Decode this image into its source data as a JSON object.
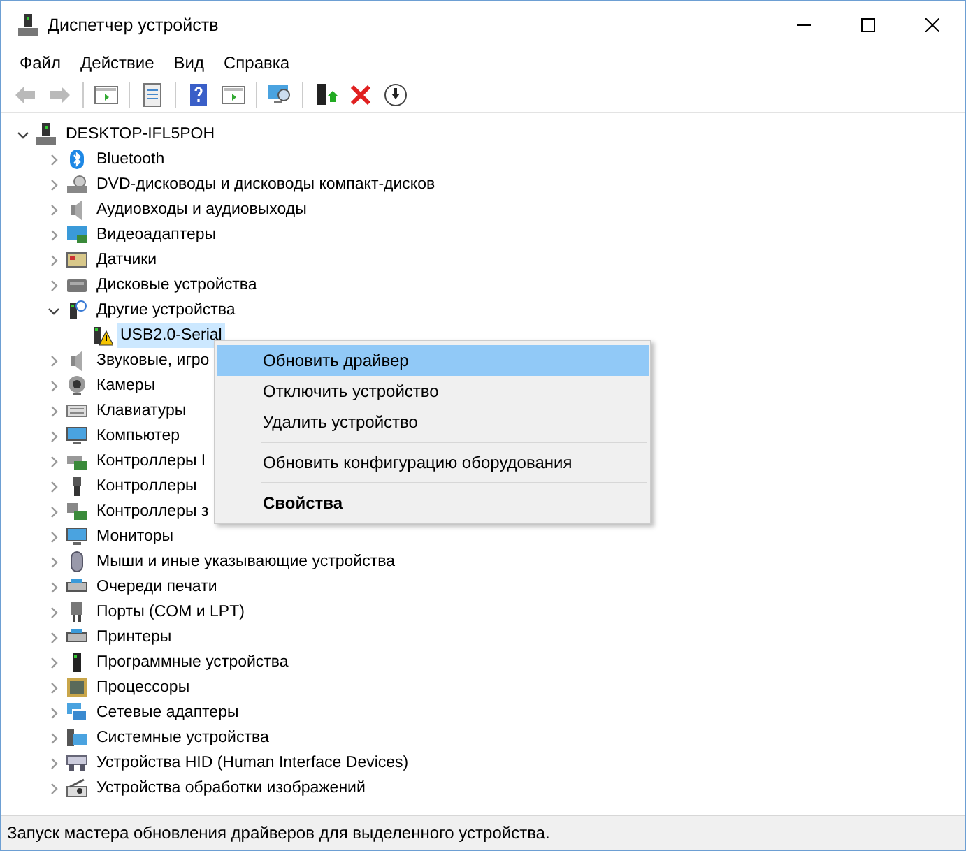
{
  "window": {
    "title": "Диспетчер устройств"
  },
  "menu_bar": [
    "Файл",
    "Действие",
    "Вид",
    "Справка"
  ],
  "toolbar": [
    {
      "disabled": true
    },
    {
      "disabled": true
    },
    {
      "disabled": false
    },
    {
      "disabled": false
    },
    {
      "disabled": false
    },
    {
      "disabled": false
    },
    {
      "disabled": false
    },
    {
      "disabled": false
    },
    {
      "disabled": false
    },
    {
      "disabled": false
    }
  ],
  "tree": {
    "label": "DESKTOP-IFL5POH",
    "expanded": true,
    "selected": false,
    "children": [
      {
        "label": "Bluetooth",
        "expanded": false,
        "selected": false
      },
      {
        "label": "DVD-дисководы и дисководы компакт-дисков",
        "expanded": false,
        "selected": false
      },
      {
        "label": "Аудиовходы и аудиовыходы",
        "expanded": false,
        "selected": false
      },
      {
        "label": "Видеоадаптеры",
        "expanded": false,
        "selected": false
      },
      {
        "label": "Датчики",
        "expanded": false,
        "selected": false
      },
      {
        "label": "Дисковые устройства",
        "expanded": false,
        "selected": false
      },
      {
        "label": "Другие устройства",
        "expanded": true,
        "selected": false,
        "children": [
          {
            "label": "USB2.0-Serial",
            "selected": true
          }
        ]
      },
      {
        "label": "Звуковые, игро",
        "expanded": false,
        "selected": false
      },
      {
        "label": "Камеры",
        "expanded": false,
        "selected": false
      },
      {
        "label": "Клавиатуры",
        "expanded": false,
        "selected": false
      },
      {
        "label": "Компьютер",
        "expanded": false,
        "selected": false
      },
      {
        "label": "Контроллеры I",
        "expanded": false,
        "selected": false
      },
      {
        "label": "Контроллеры",
        "expanded": false,
        "selected": false
      },
      {
        "label": "Контроллеры з",
        "expanded": false,
        "selected": false
      },
      {
        "label": "Мониторы",
        "expanded": false,
        "selected": false
      },
      {
        "label": "Мыши и иные указывающие устройства",
        "expanded": false,
        "selected": false
      },
      {
        "label": "Очереди печати",
        "expanded": false,
        "selected": false
      },
      {
        "label": "Порты (COM и LPT)",
        "expanded": false,
        "selected": false
      },
      {
        "label": "Принтеры",
        "expanded": false,
        "selected": false
      },
      {
        "label": "Программные устройства",
        "expanded": false,
        "selected": false
      },
      {
        "label": "Процессоры",
        "expanded": false,
        "selected": false
      },
      {
        "label": "Сетевые адаптеры",
        "expanded": false,
        "selected": false
      },
      {
        "label": "Системные устройства",
        "expanded": false,
        "selected": false
      },
      {
        "label": "Устройства HID (Human Interface Devices)",
        "expanded": false,
        "selected": false
      },
      {
        "label": "Устройства обработки изображений",
        "expanded": false,
        "selected": false
      }
    ]
  },
  "context_menu": [
    {
      "kind": "item",
      "label": "Обновить драйвер",
      "selected": true,
      "default": false
    },
    {
      "kind": "item",
      "label": "Отключить устройство",
      "selected": false,
      "default": false
    },
    {
      "kind": "item",
      "label": "Удалить устройство",
      "selected": false,
      "default": false
    },
    {
      "kind": "separator"
    },
    {
      "kind": "item",
      "label": "Обновить конфигурацию оборудования",
      "selected": false,
      "default": false
    },
    {
      "kind": "separator"
    },
    {
      "kind": "item",
      "label": "Свойства",
      "selected": false,
      "default": true
    }
  ],
  "status_bar": "Запуск мастера обновления драйверов для выделенного устройства."
}
